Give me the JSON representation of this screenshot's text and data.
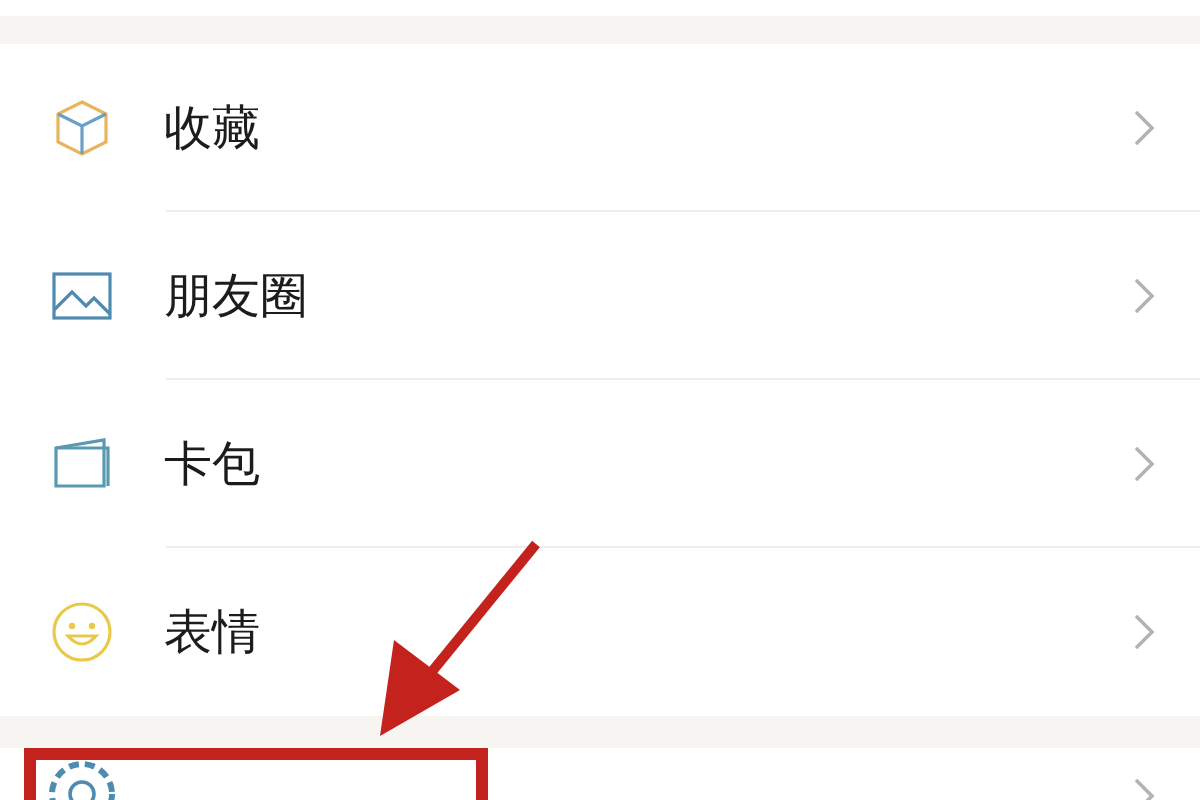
{
  "groups": [
    {
      "items": [
        {
          "kind": "cube",
          "label": "收藏"
        },
        {
          "kind": "image",
          "label": "朋友圈"
        },
        {
          "kind": "card",
          "label": "卡包"
        },
        {
          "kind": "smiley",
          "label": "表情"
        }
      ]
    },
    {
      "items": [
        {
          "kind": "gear"
        }
      ]
    }
  ]
}
